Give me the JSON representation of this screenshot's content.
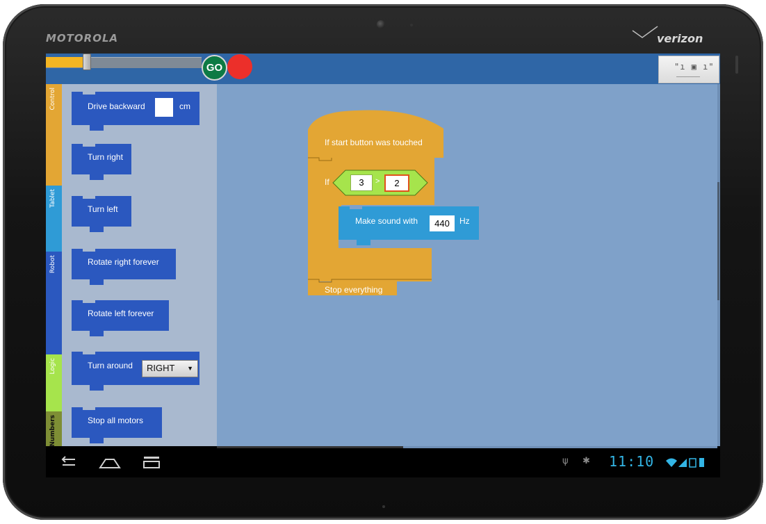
{
  "device": {
    "brand": "MOTOROLA",
    "carrier": "verizon"
  },
  "toolbar": {
    "speed_slider_fraction": 0.26,
    "go_label": "GO",
    "stop_color": "#ec2f2a",
    "menu_icon": "overflow-grid-icon"
  },
  "tabs": [
    {
      "label": "Control",
      "color": "#e3a634"
    },
    {
      "label": "Tablet",
      "color": "#2f9bd6"
    },
    {
      "label": "Robot",
      "color": "#2b58bf"
    },
    {
      "label": "Logic",
      "color": "#a6e44c"
    },
    {
      "label": "Numbers",
      "color": "#7e8e35"
    }
  ],
  "palette": {
    "drive_backward": {
      "text": "Drive backward",
      "unit": "cm",
      "value": ""
    },
    "turn_right": "Turn right",
    "turn_left": "Turn left",
    "rotate_right_forever": "Rotate right forever",
    "rotate_left_forever": "Rotate left forever",
    "turn_around": {
      "text": "Turn around",
      "option": "RIGHT"
    },
    "stop_all_motors": "Stop all motors"
  },
  "program": {
    "hat": "If start button was touched",
    "if_label": "If",
    "compare_left": "3",
    "compare_op": ">",
    "compare_right": "2",
    "sound": {
      "text": "Make sound with",
      "value": "440",
      "unit": "Hz"
    },
    "stop": "Stop everything"
  },
  "status_bar": {
    "time": "11:10"
  },
  "colors": {
    "action_bar": "#2f66a6",
    "canvas": "#7fa1c9",
    "palette": "#a9b9cf",
    "robot_block": "#2b58bf",
    "control_block": "#e3a634",
    "tablet_block": "#2f9bd6",
    "logic_block": "#a6e44c"
  }
}
